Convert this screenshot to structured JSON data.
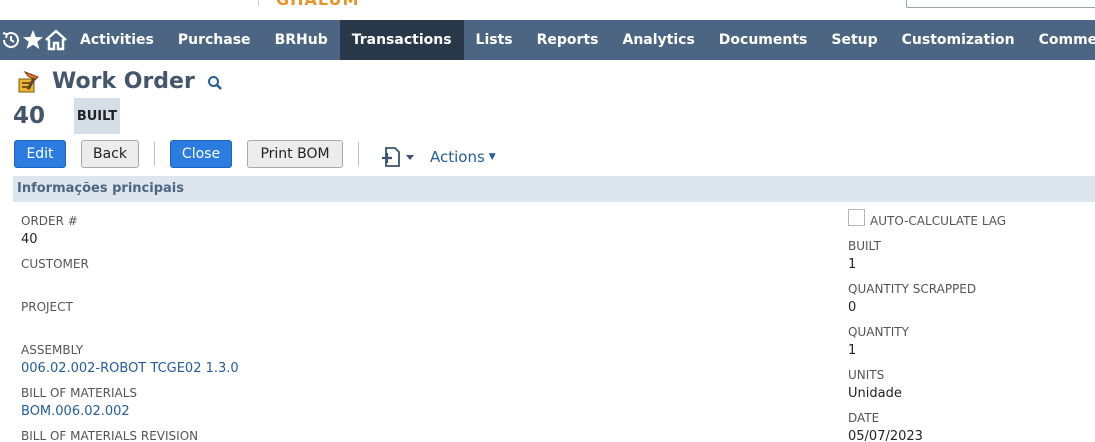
{
  "header": {
    "logo_text": "GHALUM",
    "search_placeholder": ""
  },
  "nav": {
    "items": [
      {
        "label": "Activities"
      },
      {
        "label": "Purchase"
      },
      {
        "label": "BRHub"
      },
      {
        "label": "Transactions",
        "active": true
      },
      {
        "label": "Lists"
      },
      {
        "label": "Reports"
      },
      {
        "label": "Analytics"
      },
      {
        "label": "Documents"
      },
      {
        "label": "Setup"
      },
      {
        "label": "Customization"
      },
      {
        "label": "Commerce"
      }
    ]
  },
  "page": {
    "title": "Work Order",
    "record_id": "40",
    "status": "BUILT"
  },
  "toolbar": {
    "edit_label": "Edit",
    "back_label": "Back",
    "close_label": "Close",
    "print_bom_label": "Print BOM",
    "actions_label": "Actions"
  },
  "section": {
    "title": "Informações principais"
  },
  "left_fields": {
    "order_label": "ORDER #",
    "order_value": "40",
    "customer_label": "CUSTOMER",
    "customer_value": "",
    "project_label": "PROJECT",
    "project_value": "",
    "assembly_label": "ASSEMBLY",
    "assembly_value": "006.02.002-ROBOT TCGE02 1.3.0",
    "bom_label": "BILL OF MATERIALS",
    "bom_value": "BOM.006.02.002",
    "bom_revision_label": "BILL OF MATERIALS REVISION"
  },
  "right_fields": {
    "auto_calc_label": "AUTO-CALCULATE LAG",
    "auto_calc_checked": false,
    "built_label": "BUILT",
    "built_value": "1",
    "scrapped_label": "QUANTITY SCRAPPED",
    "scrapped_value": "0",
    "quantity_label": "QUANTITY",
    "quantity_value": "1",
    "units_label": "UNITS",
    "units_value": "Unidade",
    "date_label": "DATE",
    "date_value": "05/07/2023"
  },
  "colors": {
    "nav_bg": "#4b6583",
    "nav_active": "#283848",
    "primary_button": "#2b7ce0",
    "section_bg": "#dde5ee",
    "link": "#255d99"
  }
}
